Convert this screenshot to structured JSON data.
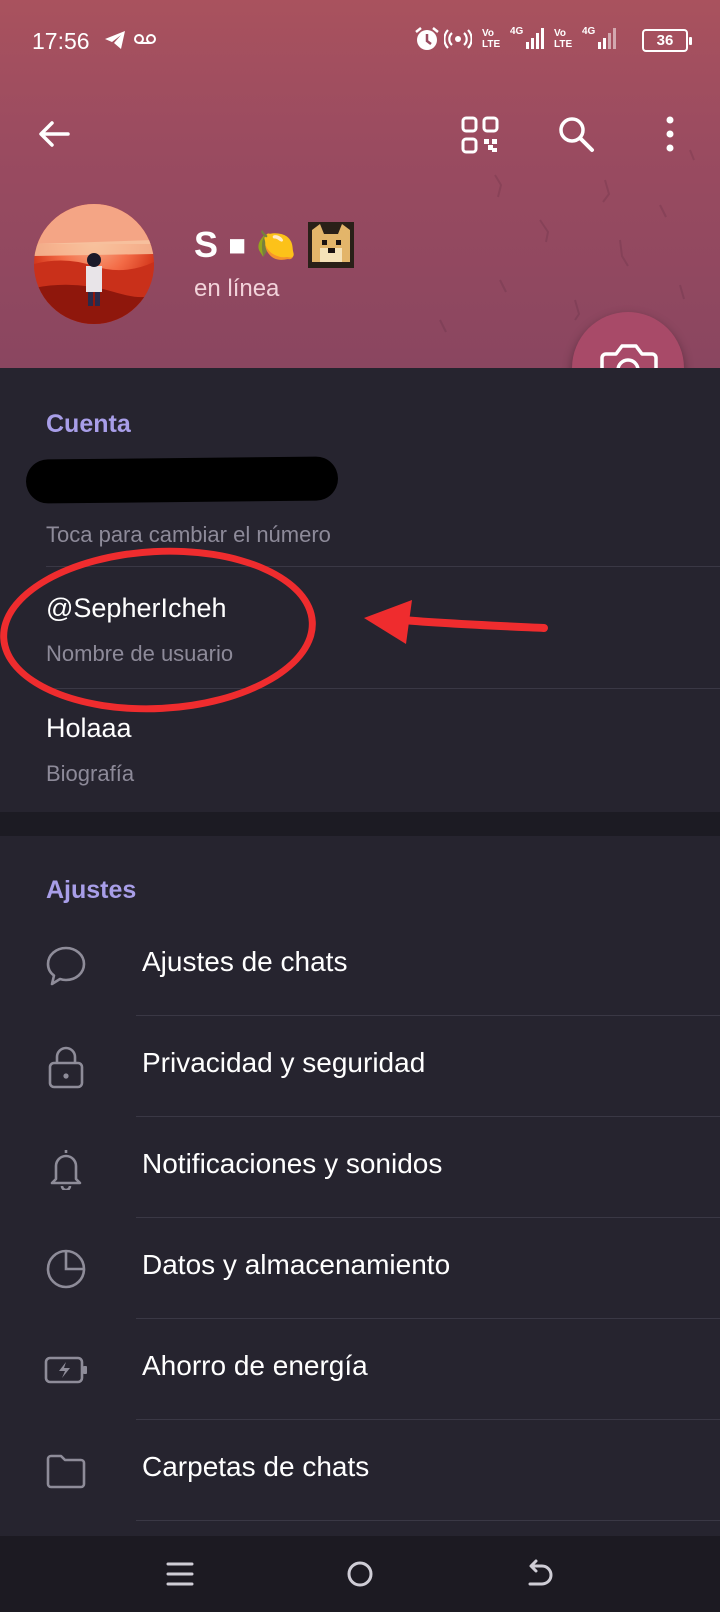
{
  "status_bar": {
    "time": "17:56",
    "volte_1": "Vo LTE",
    "net_1": "4G",
    "volte_2": "Vo LTE",
    "net_2": "4G",
    "battery_level": 36,
    "icons": [
      "telegram-icon",
      "voicemail-icon",
      "alarm-icon",
      "hotspot-icon",
      "signal-icon",
      "battery-icon"
    ]
  },
  "toolbar": {
    "icons": [
      "back-arrow-icon",
      "qr-code-icon",
      "search-icon",
      "more-vert-icon"
    ]
  },
  "profile": {
    "name": "S",
    "emoji_1": "◼",
    "emoji_2": "🍋",
    "status": "en línea"
  },
  "account": {
    "header": "Cuenta",
    "phone_hint": "Toca para cambiar el número",
    "username": "@SepherIcheh",
    "username_hint": "Nombre de usuario",
    "bio": "Holaaa",
    "bio_hint": "Biografía"
  },
  "settings": {
    "header": "Ajustes",
    "items": [
      {
        "label": "Ajustes de chats",
        "icon": "chat-bubble-icon"
      },
      {
        "label": "Privacidad y seguridad",
        "icon": "lock-icon"
      },
      {
        "label": "Notificaciones y sonidos",
        "icon": "bell-icon"
      },
      {
        "label": "Datos y almacenamiento",
        "icon": "pie-chart-icon"
      },
      {
        "label": "Ahorro de energía",
        "icon": "battery-charge-icon"
      },
      {
        "label": "Carpetas de chats",
        "icon": "folder-icon"
      }
    ]
  },
  "colors": {
    "header_bg": "#9a4b60",
    "accent": "#a89ee8",
    "background": "#26242f",
    "annotation": "#ef2c2e"
  },
  "nav_bar": {
    "icons": [
      "menu-icon",
      "home-icon",
      "back-icon"
    ]
  }
}
